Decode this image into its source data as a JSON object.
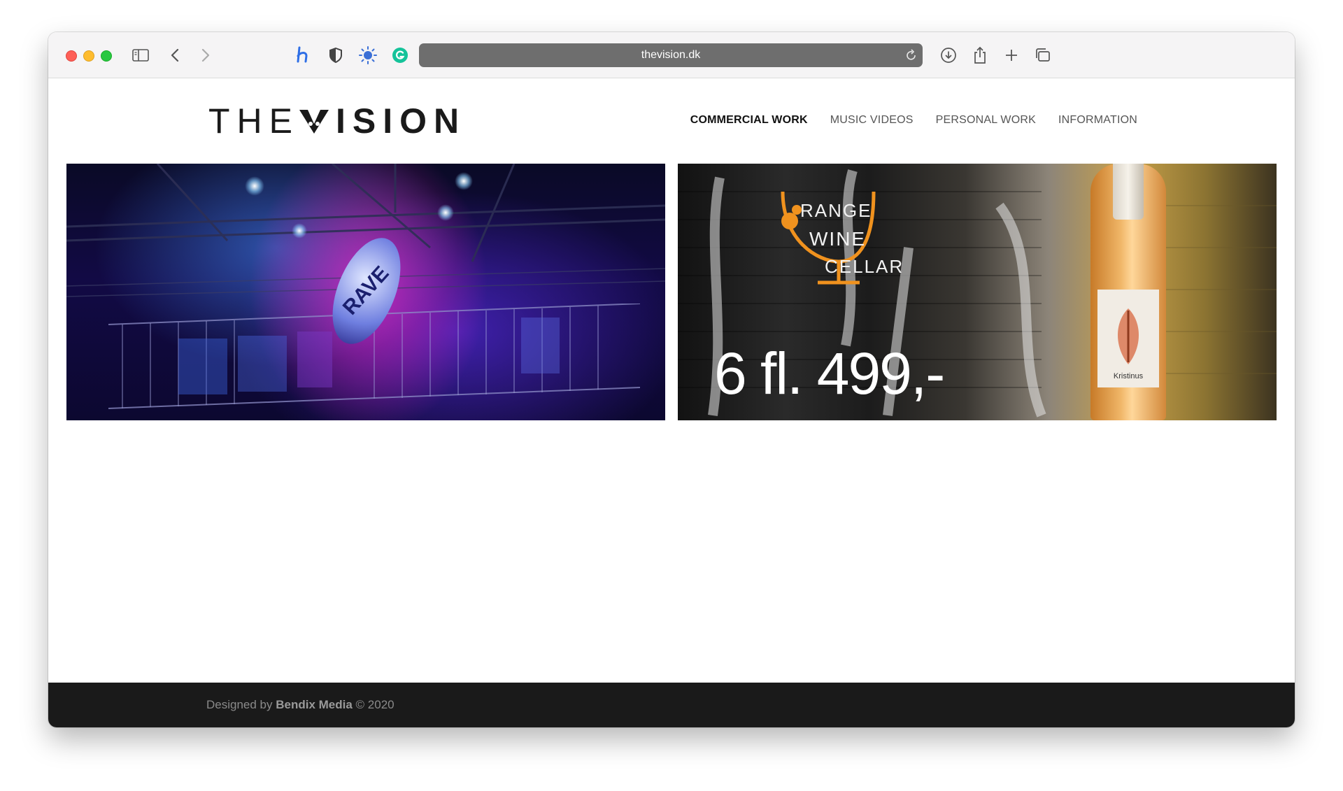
{
  "browser": {
    "url": "thevision.dk",
    "extensions": [
      "honey-icon",
      "shield-icon",
      "sun-icon",
      "grammarly-icon"
    ]
  },
  "site": {
    "logo_light": "THE",
    "logo_bold": "ISION",
    "nav": [
      {
        "label": "COMMERCIAL WORK",
        "active": true
      },
      {
        "label": "MUSIC VIDEOS",
        "active": false
      },
      {
        "label": "PERSONAL WORK",
        "active": false
      },
      {
        "label": "INFORMATION",
        "active": false
      }
    ]
  },
  "tiles": {
    "left": {
      "sign_text": "RAVE"
    },
    "right": {
      "logo_lines": [
        "RANGE",
        "WINE",
        "CELLAR"
      ],
      "price": "6 fl. 499,-",
      "bottle_label": "Kristinus"
    }
  },
  "footer": {
    "prefix": "Designed by ",
    "brand": "Bendix Media",
    "suffix": " © 2020"
  },
  "colors": {
    "accent_orange": "#f0921e",
    "footer_bg": "#1a1a1a",
    "address_bar": "#6e6e6e"
  }
}
